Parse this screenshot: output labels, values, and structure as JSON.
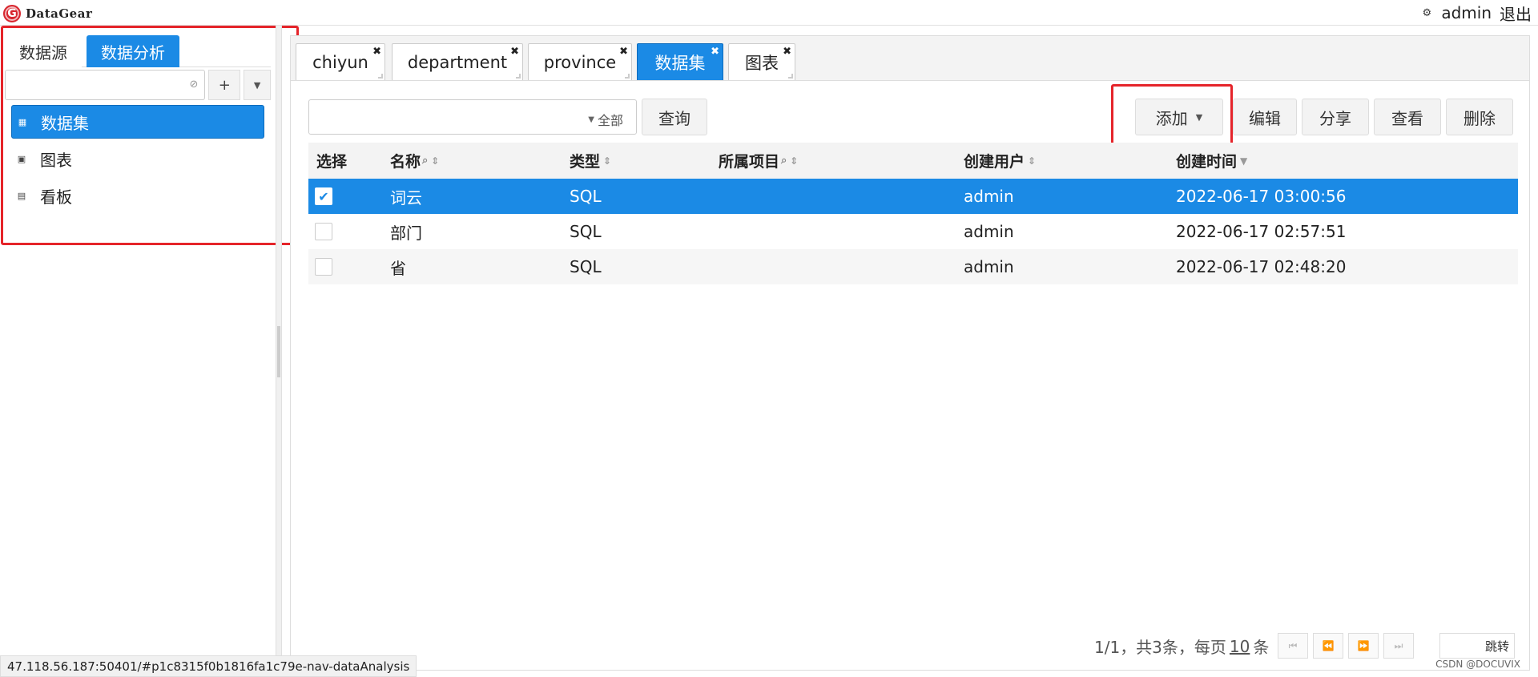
{
  "header": {
    "logo_mark": "G",
    "logo_text": "DataGear",
    "gear_icon": "⚙",
    "username": "admin",
    "logout": "退出"
  },
  "left": {
    "tabs": [
      "数据源",
      "数据分析"
    ],
    "active_tab_index": 1,
    "search": {
      "value": "",
      "placeholder": ""
    },
    "add_label": "+",
    "nav": [
      {
        "label": "数据集",
        "icon": "dataset-icon",
        "active": true
      },
      {
        "label": "图表",
        "icon": "chart-icon",
        "active": false
      },
      {
        "label": "看板",
        "icon": "dashboard-icon",
        "active": false
      }
    ]
  },
  "main": {
    "tabs": [
      {
        "label": "chiyun",
        "active": false
      },
      {
        "label": "department",
        "active": false
      },
      {
        "label": "province",
        "active": false
      },
      {
        "label": "数据集",
        "active": true
      },
      {
        "label": "图表",
        "active": false
      }
    ],
    "search": {
      "value": "",
      "scope": "全部"
    },
    "query_label": "查询",
    "actions": {
      "add": "添加",
      "edit": "编辑",
      "share": "分享",
      "view": "查看",
      "delete": "删除"
    },
    "table": {
      "columns": [
        "选择",
        "名称",
        "类型",
        "所属项目",
        "创建用户",
        "创建时间"
      ],
      "rows": [
        {
          "name": "词云",
          "type": "SQL",
          "project": "",
          "user": "admin",
          "created": "2022-06-17 03:00:56",
          "selected": true
        },
        {
          "name": "部门",
          "type": "SQL",
          "project": "",
          "user": "admin",
          "created": "2022-06-17 02:57:51",
          "selected": false
        },
        {
          "name": "省",
          "type": "SQL",
          "project": "",
          "user": "admin",
          "created": "2022-06-17 02:48:20",
          "selected": false
        }
      ]
    },
    "pager": {
      "summary": "1/1，共3条，每页",
      "per_page": "10",
      "unit": "条",
      "jump_label": "跳转"
    }
  },
  "status_url": "47.118.56.187:50401/#p1c8315f0b1816fa1c79e-nav-dataAnalysis",
  "watermark": "CSDN @DOCUVIX",
  "colors": {
    "accent": "#1b8ae5",
    "highlight_box": "#e5242a",
    "logo": "#d8262e"
  }
}
